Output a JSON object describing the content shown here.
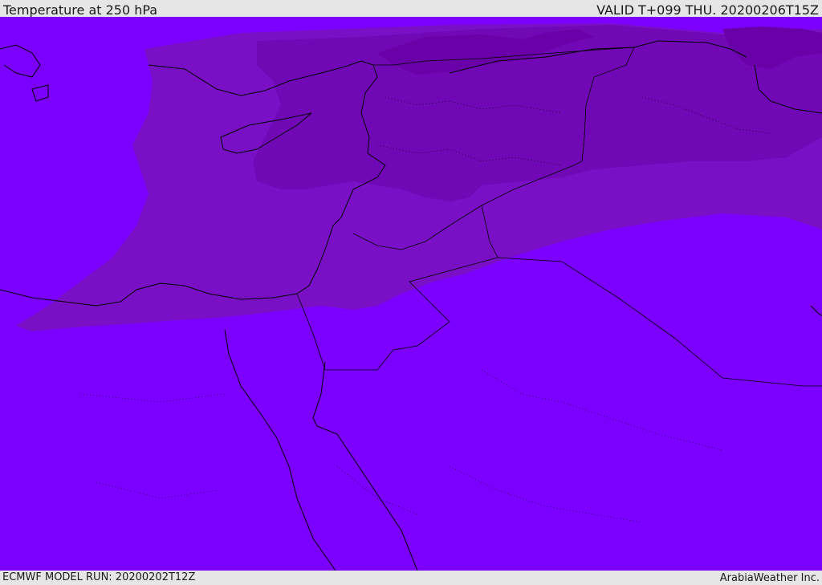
{
  "header": {
    "title": "Temperature at 250 hPa",
    "valid_time": "VALID T+099 THU. 20200206T15Z"
  },
  "footer": {
    "model_run": "ECMWF MODEL RUN: 20200202T12Z",
    "credit": "ArabiaWeather Inc."
  },
  "map": {
    "colors": {
      "coldest": "#6a00a8",
      "colder": "#7108b6",
      "cold": "#7a10c6",
      "base": "#7b00ff",
      "coastline": "#000000"
    }
  }
}
